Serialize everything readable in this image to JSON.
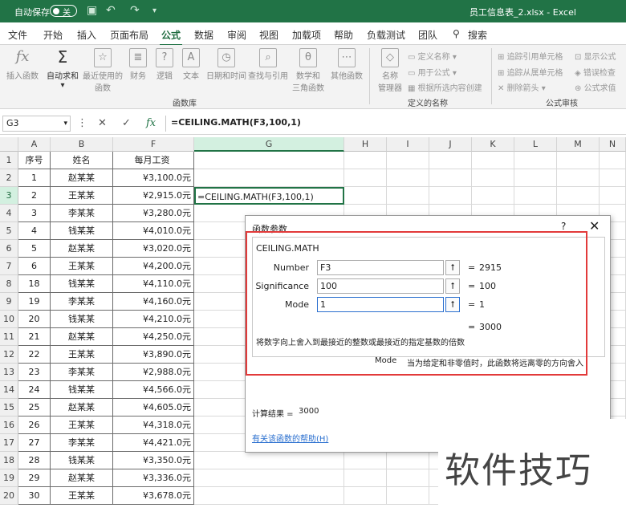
{
  "titlebar": {
    "autosave_label": "自动保存",
    "autosave_state": "关",
    "document_title": "员工信息表_2.xlsx  -  Excel"
  },
  "tabs": [
    "文件",
    "开始",
    "插入",
    "页面布局",
    "公式",
    "数据",
    "审阅",
    "视图",
    "加载项",
    "帮助",
    "负载测试",
    "团队",
    "搜索"
  ],
  "active_tab": "公式",
  "ribbon": {
    "insert_function": "插入函数",
    "autosum": "自动求和",
    "recent": "最近使用的\n函数",
    "financial": "财务",
    "logical": "逻辑",
    "text": "文本",
    "datetime": "日期和时间",
    "lookup": "查找与引用",
    "math": "数学和\n三角函数",
    "other": "其他函数",
    "group_library": "函数库",
    "name_manager": "名称\n管理器",
    "define_name": "定义名称",
    "use_in_formula": "用于公式",
    "create_from_selection": "根据所选内容创建",
    "group_names": "定义的名称",
    "trace_precedents": "追踪引用单元格",
    "trace_dependents": "追踪从属单元格",
    "remove_arrows": "删除箭头",
    "show_formulas": "显示公式",
    "error_checking": "错误检查",
    "evaluate_formula": "公式求值",
    "group_audit": "公式审核"
  },
  "formula_bar": {
    "name_box": "G3",
    "formula": "=CEILING.MATH(F3,100,1)"
  },
  "columns": [
    "A",
    "B",
    "F",
    "G",
    "H",
    "I",
    "J",
    "K",
    "L",
    "M",
    "N"
  ],
  "headers": {
    "a": "序号",
    "b": "姓名",
    "f": "每月工资"
  },
  "rows": [
    {
      "n": "1",
      "a": "1",
      "b": "赵某某",
      "f": "¥3,100.0元"
    },
    {
      "n": "2",
      "a": "2",
      "b": "王某某",
      "f": "¥2,915.0元"
    },
    {
      "n": "3",
      "a": "3",
      "b": "李某某",
      "f": "¥3,280.0元"
    },
    {
      "n": "4",
      "a": "4",
      "b": "钱某某",
      "f": "¥4,010.0元"
    },
    {
      "n": "5",
      "a": "5",
      "b": "赵某某",
      "f": "¥3,020.0元"
    },
    {
      "n": "6",
      "a": "6",
      "b": "王某某",
      "f": "¥4,200.0元"
    },
    {
      "n": "7",
      "a": "18",
      "b": "钱某某",
      "f": "¥4,110.0元"
    },
    {
      "n": "8",
      "a": "19",
      "b": "李某某",
      "f": "¥4,160.0元"
    },
    {
      "n": "10",
      "a": "20",
      "b": "钱某某",
      "f": "¥4,210.0元"
    },
    {
      "n": "11",
      "a": "21",
      "b": "赵某某",
      "f": "¥4,250.0元"
    },
    {
      "n": "12",
      "a": "22",
      "b": "王某某",
      "f": "¥3,890.0元"
    },
    {
      "n": "13",
      "a": "23",
      "b": "李某某",
      "f": "¥2,988.0元"
    },
    {
      "n": "14",
      "a": "24",
      "b": "钱某某",
      "f": "¥4,566.0元"
    },
    {
      "n": "15",
      "a": "25",
      "b": "赵某某",
      "f": "¥4,605.0元"
    },
    {
      "n": "16",
      "a": "26",
      "b": "王某某",
      "f": "¥4,318.0元"
    },
    {
      "n": "17",
      "a": "27",
      "b": "李某某",
      "f": "¥4,421.0元"
    },
    {
      "n": "18",
      "a": "28",
      "b": "钱某某",
      "f": "¥3,350.0元"
    },
    {
      "n": "19",
      "a": "29",
      "b": "赵某某",
      "f": "¥3,336.0元"
    },
    {
      "n": "20",
      "a": "30",
      "b": "王某某",
      "f": "¥3,678.0元"
    }
  ],
  "g3_content": "=CEILING.MATH(F3,100,1)",
  "dialog": {
    "title": "函数参数",
    "help_mark": "?",
    "close": "✕",
    "function_name": "CEILING.MATH",
    "args": [
      {
        "label": "Number",
        "value": "F3",
        "result": "2915"
      },
      {
        "label": "Significance",
        "value": "100",
        "result": "100"
      },
      {
        "label": "Mode",
        "value": "1",
        "result": "1"
      }
    ],
    "equals": "=",
    "overall_result": "3000",
    "description": "将数字向上舍入到最接近的整数或最接近的指定基数的倍数",
    "mode_name": "Mode",
    "mode_description": "当为给定和非零值时，此函数将远离零的方向舍入",
    "calc_label": "计算结果 =",
    "calc_value": "3000",
    "help_link": "有关该函数的帮助(H)"
  },
  "watermark": "软件技巧"
}
